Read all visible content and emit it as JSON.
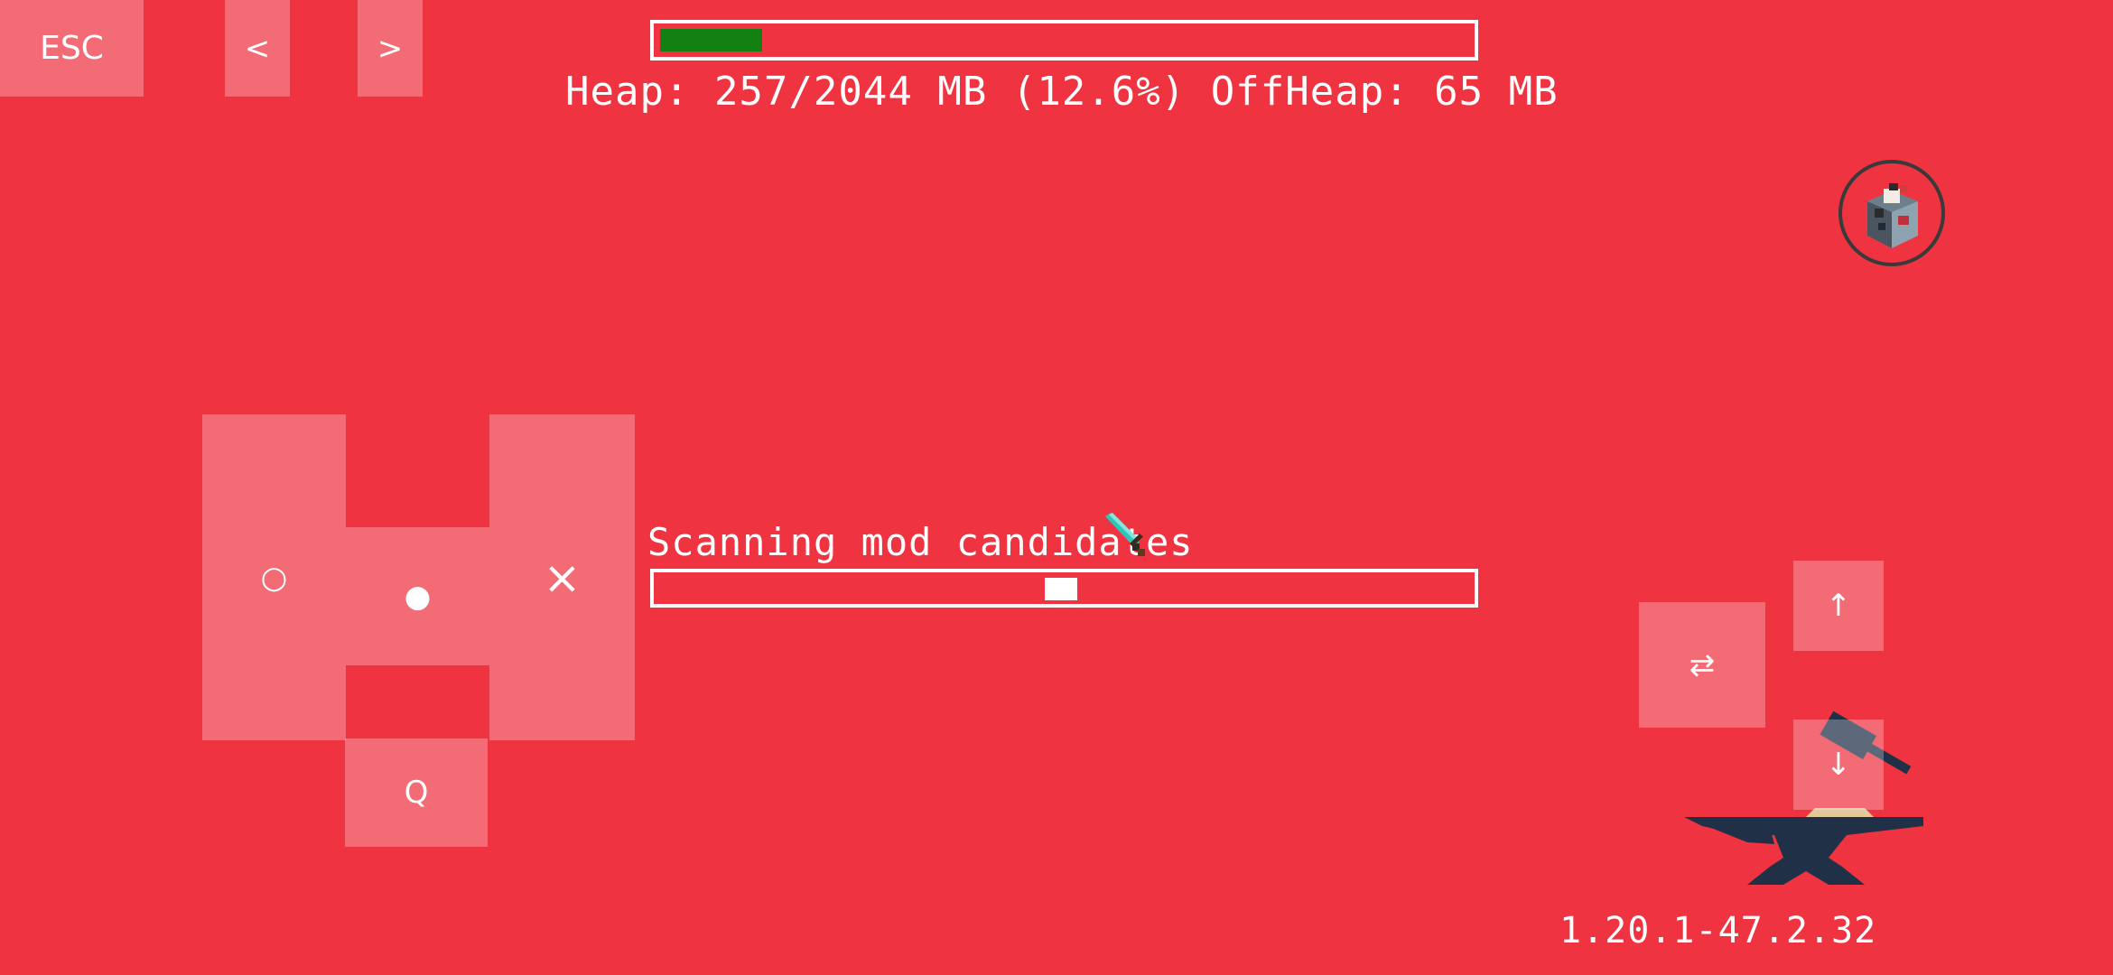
{
  "controls": {
    "esc_label": "ESC",
    "prev_label": "<",
    "next_label": ">",
    "left_cluster": {
      "left_glyph": "○",
      "center_glyph": "●",
      "right_glyph": "×",
      "q_label": "Q"
    },
    "swap_glyph": "⇄",
    "up_glyph": "↑",
    "down_glyph": "↓"
  },
  "memory": {
    "text": "Heap: 257/2044 MB (12.6%) OffHeap: 65 MB",
    "usage_fraction": 0.126
  },
  "loading": {
    "status": "Scanning mod candidates",
    "indeterminate_marker_position_fraction": 0.5
  },
  "version": "1.20.1-47.2.32",
  "colors": {
    "background": "#ef3340",
    "memory_fill": "#128012",
    "bar_border": "#ffffff",
    "anvil": "#1f3047"
  },
  "icons": {
    "launcher": "launcher-avatar-icon",
    "cursor": "diamond-sword-cursor-icon",
    "logo": "forge-anvil-icon"
  }
}
